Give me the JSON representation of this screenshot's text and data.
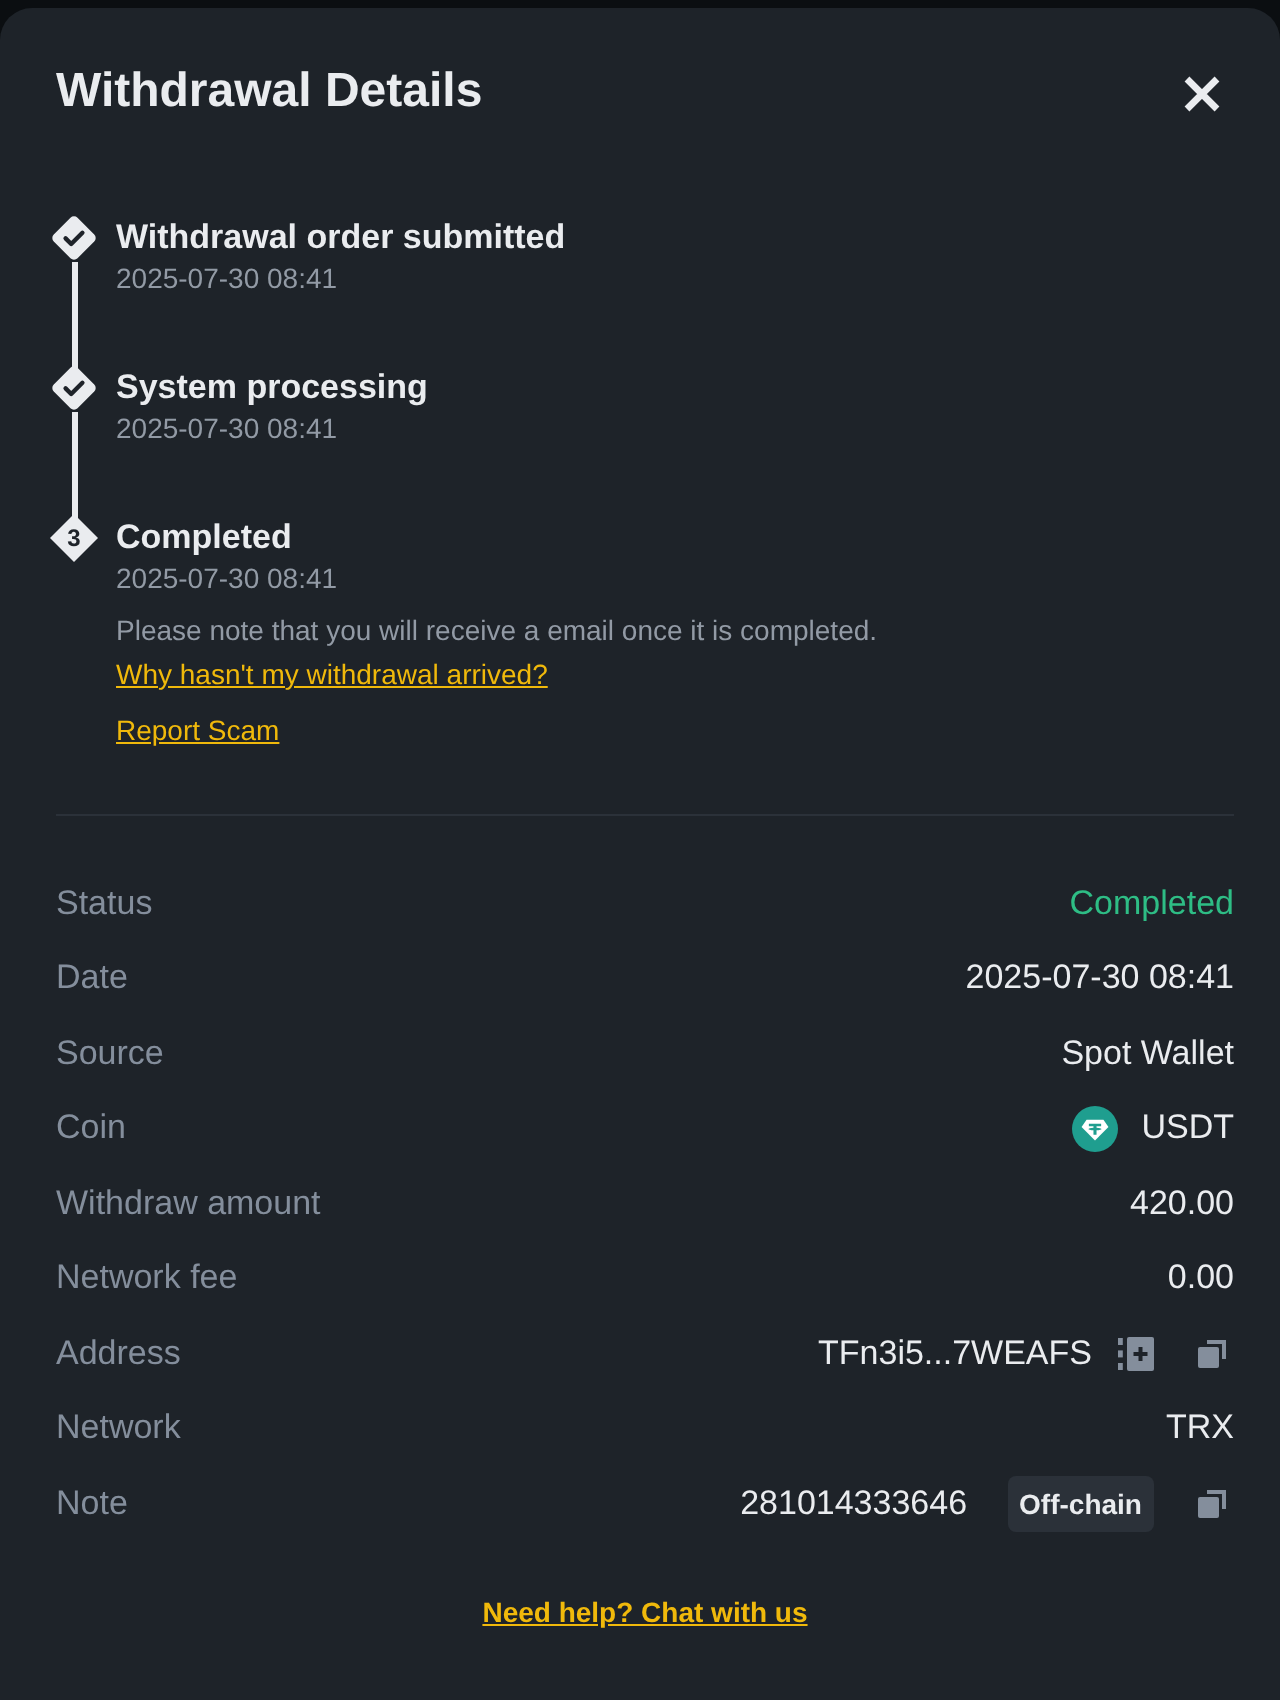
{
  "window": {
    "title": "Withdrawal Details"
  },
  "steps": [
    {
      "title": "Withdrawal order submitted",
      "time": "2025-07-30 08:41",
      "done": true
    },
    {
      "title": "System processing",
      "time": "2025-07-30 08:41",
      "done": true
    },
    {
      "title": "Completed",
      "time": "2025-07-30 08:41",
      "done": false,
      "number": "3",
      "note": "Please note that you will receive a email once it is completed.",
      "links": [
        "Why hasn't my withdrawal arrived?",
        "Report Scam"
      ]
    }
  ],
  "details": [
    {
      "label": "Status",
      "value": "Completed",
      "kind": "status"
    },
    {
      "label": "Date",
      "value": "2025-07-30 08:41",
      "kind": "text"
    },
    {
      "label": "Source",
      "value": "Spot Wallet",
      "kind": "text"
    },
    {
      "label": "Coin",
      "value": "USDT",
      "kind": "coin"
    },
    {
      "label": "Withdraw amount",
      "value": "420.00",
      "kind": "text"
    },
    {
      "label": "Network fee",
      "value": "0.00",
      "kind": "text"
    },
    {
      "label": "Address",
      "value": "TFn3i5...7WEAFS",
      "kind": "address"
    },
    {
      "label": "Network",
      "value": "TRX",
      "kind": "text"
    },
    {
      "label": "Note",
      "value": "281014333646",
      "kind": "note",
      "tag": "Off-chain"
    }
  ],
  "help_link": "Need help? Chat with us"
}
